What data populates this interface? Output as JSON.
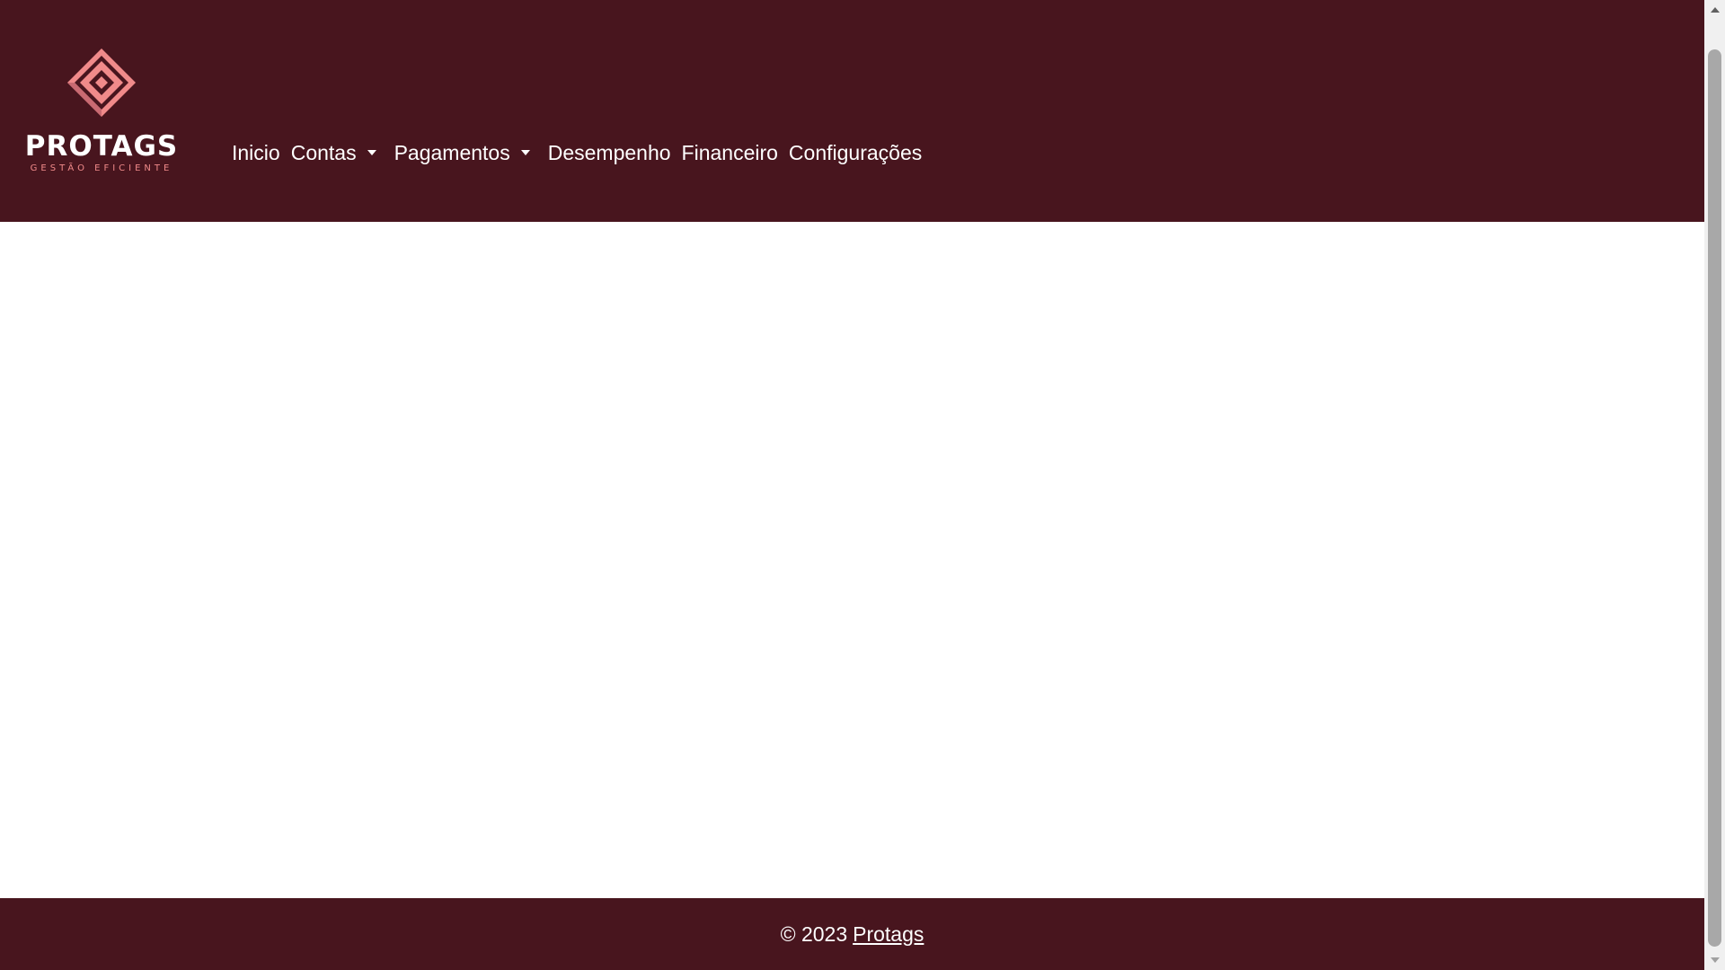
{
  "brand": {
    "logo_text": "PROTAGS",
    "tagline": "GESTÃO EFICIENTE",
    "colors": {
      "accent": "#f08a8a",
      "dark": "#48151e",
      "text": "#ffffff"
    }
  },
  "nav": {
    "items": [
      {
        "label": "Inicio",
        "has_dropdown": false
      },
      {
        "label": "Contas",
        "has_dropdown": true
      },
      {
        "label": "Pagamentos",
        "has_dropdown": true
      },
      {
        "label": "Desempenho",
        "has_dropdown": false
      },
      {
        "label": "Financeiro",
        "has_dropdown": false
      },
      {
        "label": "Configurações",
        "has_dropdown": false
      }
    ]
  },
  "footer": {
    "copyright": "© 2023",
    "link": "Protags"
  },
  "theme": {
    "header_bg": "#48151e",
    "footer_bg": "#48151e",
    "page_bg": "#ffffff"
  }
}
